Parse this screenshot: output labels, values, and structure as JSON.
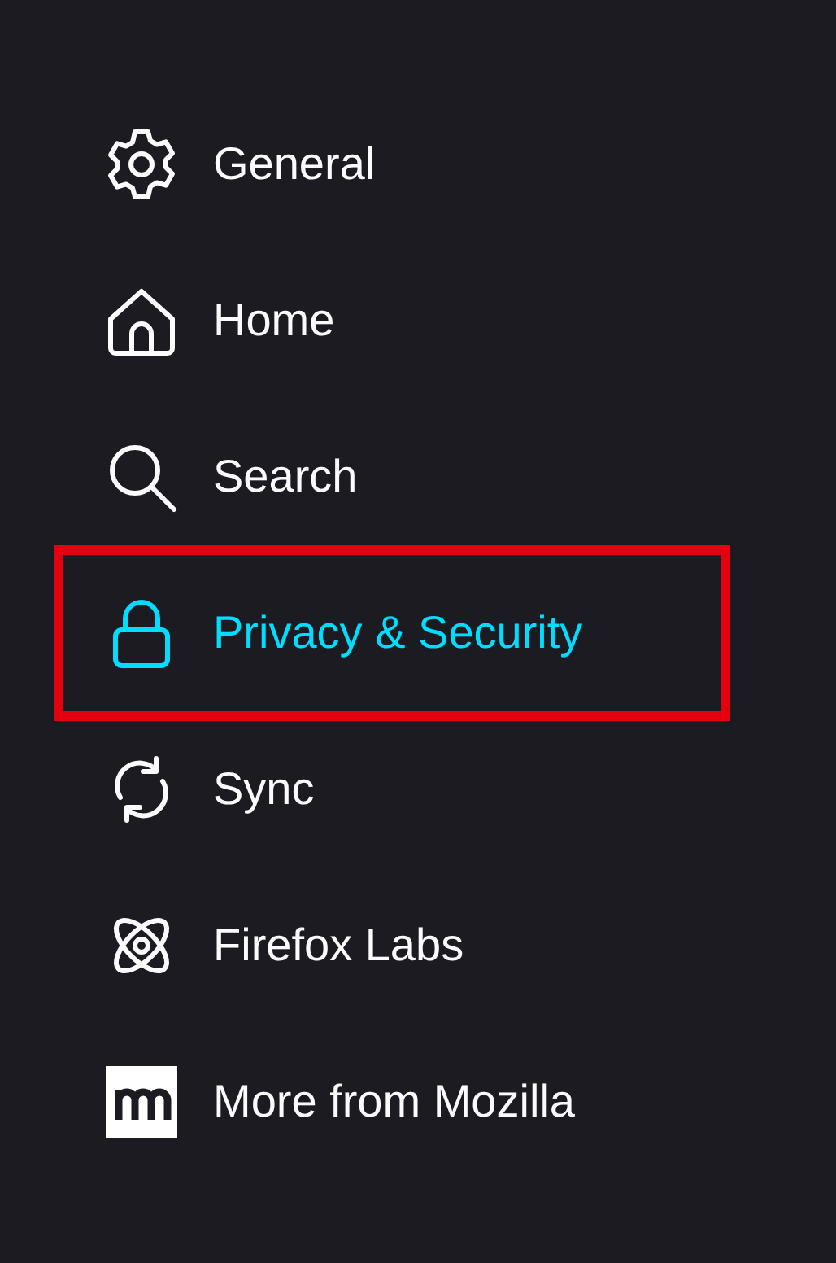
{
  "sidebar": {
    "items": [
      {
        "label": "General",
        "selected": false,
        "highlighted": false
      },
      {
        "label": "Home",
        "selected": false,
        "highlighted": false
      },
      {
        "label": "Search",
        "selected": false,
        "highlighted": false
      },
      {
        "label": "Privacy & Security",
        "selected": true,
        "highlighted": true
      },
      {
        "label": "Sync",
        "selected": false,
        "highlighted": false
      },
      {
        "label": "Firefox Labs",
        "selected": false,
        "highlighted": false
      },
      {
        "label": "More from Mozilla",
        "selected": false,
        "highlighted": false
      }
    ]
  }
}
